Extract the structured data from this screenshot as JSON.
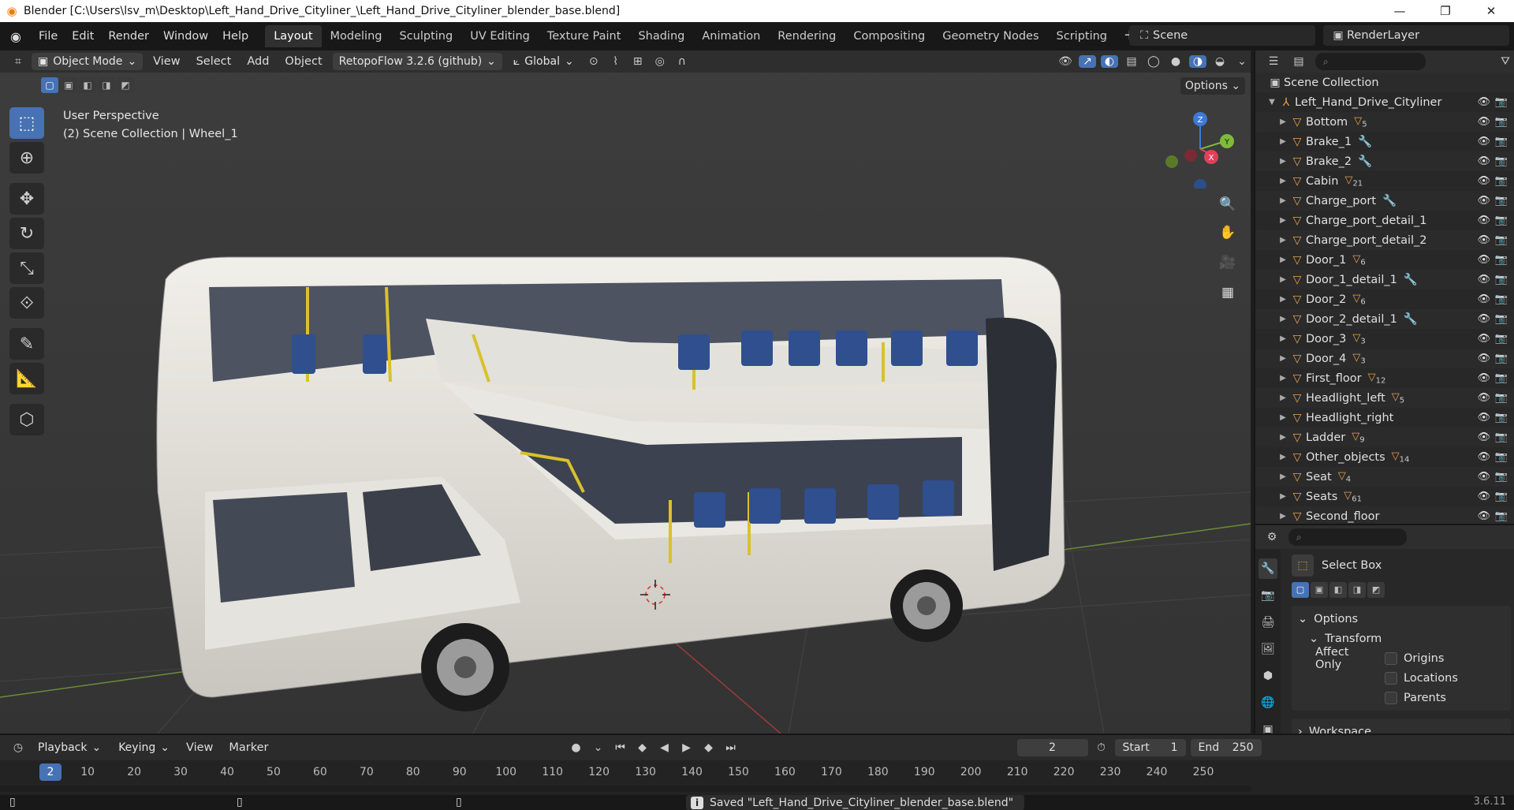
{
  "window": {
    "title": "Blender [C:\\Users\\lsv_m\\Desktop\\Left_Hand_Drive_Cityliner_\\Left_Hand_Drive_Cityliner_blender_base.blend]",
    "minimize_icon": "minimize-icon",
    "maximize_icon": "maximize-icon",
    "close_icon": "close-icon"
  },
  "menu": {
    "items": [
      "File",
      "Edit",
      "Render",
      "Window",
      "Help"
    ],
    "workspaces": [
      "Layout",
      "Modeling",
      "Sculpting",
      "UV Editing",
      "Texture Paint",
      "Shading",
      "Animation",
      "Rendering",
      "Compositing",
      "Geometry Nodes",
      "Scripting"
    ],
    "active_workspace": "Layout",
    "add_workspace": "+",
    "scene": "Scene",
    "render_layer": "RenderLayer"
  },
  "viewport_header": {
    "mode": "Object Mode",
    "menus": [
      "View",
      "Select",
      "Add",
      "Object"
    ],
    "addon": "RetopoFlow 3.2.6 (github)",
    "orientation": "Global",
    "options": "Options"
  },
  "viewport": {
    "perspective": "User Perspective",
    "collection_info": "(2) Scene Collection | Wheel_1",
    "gizmo_axes": {
      "z": "Z",
      "y": "Y",
      "x": "X"
    }
  },
  "outliner": {
    "root": "Scene Collection",
    "collection": "Left_Hand_Drive_Cityliner",
    "items": [
      {
        "name": "Bottom",
        "badge": "5",
        "mod": false
      },
      {
        "name": "Brake_1",
        "badge": "",
        "mod": true
      },
      {
        "name": "Brake_2",
        "badge": "",
        "mod": true
      },
      {
        "name": "Cabin",
        "badge": "21",
        "mod": false
      },
      {
        "name": "Charge_port",
        "badge": "",
        "mod": true
      },
      {
        "name": "Charge_port_detail_1",
        "badge": "",
        "mod": false
      },
      {
        "name": "Charge_port_detail_2",
        "badge": "",
        "mod": false
      },
      {
        "name": "Door_1",
        "badge": "6",
        "mod": false
      },
      {
        "name": "Door_1_detail_1",
        "badge": "",
        "mod": true
      },
      {
        "name": "Door_2",
        "badge": "6",
        "mod": false
      },
      {
        "name": "Door_2_detail_1",
        "badge": "",
        "mod": true
      },
      {
        "name": "Door_3",
        "badge": "3",
        "mod": false
      },
      {
        "name": "Door_4",
        "badge": "3",
        "mod": false
      },
      {
        "name": "First_floor",
        "badge": "12",
        "mod": false
      },
      {
        "name": "Headlight_left",
        "badge": "5",
        "mod": false
      },
      {
        "name": "Headlight_right",
        "badge": "",
        "mod": false
      },
      {
        "name": "Ladder",
        "badge": "9",
        "mod": false
      },
      {
        "name": "Other_objects",
        "badge": "14",
        "mod": false
      },
      {
        "name": "Seat",
        "badge": "4",
        "mod": false
      },
      {
        "name": "Seats",
        "badge": "61",
        "mod": false
      },
      {
        "name": "Second_floor",
        "badge": "",
        "mod": false
      }
    ]
  },
  "properties": {
    "tool": "Select Box",
    "options": "Options",
    "transform": "Transform",
    "affect_only": "Affect Only",
    "origins": "Origins",
    "locations": "Locations",
    "parents": "Parents",
    "workspace": "Workspace"
  },
  "timeline": {
    "playback": "Playback",
    "keying": "Keying",
    "view": "View",
    "marker": "Marker",
    "current_frame": "2",
    "start_label": "Start",
    "start": "1",
    "end_label": "End",
    "end": "250",
    "ruler": [
      "2",
      "10",
      "20",
      "30",
      "40",
      "50",
      "60",
      "70",
      "80",
      "90",
      "100",
      "110",
      "120",
      "130",
      "140",
      "150",
      "160",
      "170",
      "180",
      "190",
      "200",
      "210",
      "220",
      "230",
      "240",
      "250"
    ]
  },
  "status": {
    "message": "Saved \"Left_Hand_Drive_Cityliner_blender_base.blend\"",
    "version": "3.6.11"
  },
  "colors": {
    "accent": "#4772b3",
    "object_orange": "#e7a24c",
    "axis_x": "#e0405a",
    "axis_y": "#7fbb3a",
    "axis_z": "#3d7ad6"
  }
}
